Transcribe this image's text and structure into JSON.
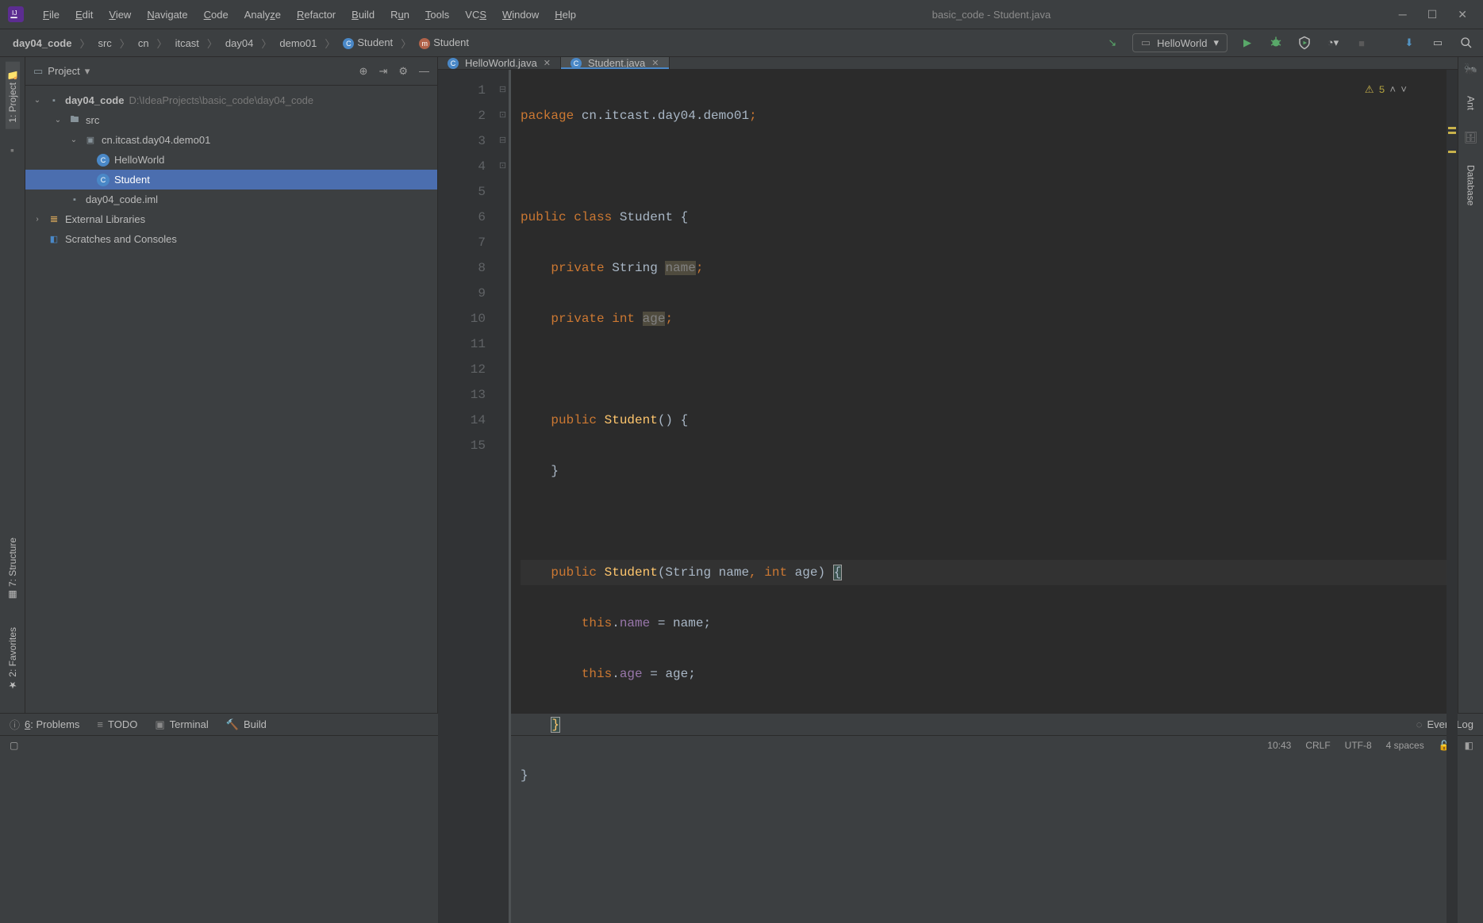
{
  "title_bar": {
    "window_title": "basic_code - Student.java",
    "menu": [
      "File",
      "Edit",
      "View",
      "Navigate",
      "Code",
      "Analyze",
      "Refactor",
      "Build",
      "Run",
      "Tools",
      "VCS",
      "Window",
      "Help"
    ],
    "menu_accel": [
      "F",
      "E",
      "V",
      "N",
      "C",
      "A",
      "R",
      "B",
      "R",
      "T",
      "V",
      "W",
      "H"
    ]
  },
  "breadcrumb": {
    "items": [
      "day04_code",
      "src",
      "cn",
      "itcast",
      "day04",
      "demo01",
      "Student",
      "Student"
    ]
  },
  "toolbar": {
    "run_config": "HelloWorld"
  },
  "project_panel": {
    "title": "Project",
    "tree": {
      "root": "day04_code",
      "root_path": "D:\\IdeaProjects\\basic_code\\day04_code",
      "src": "src",
      "pkg": "cn.itcast.day04.demo01",
      "class1": "HelloWorld",
      "class2": "Student",
      "iml": "day04_code.iml",
      "ext_lib": "External Libraries",
      "scratches": "Scratches and Consoles"
    }
  },
  "editor": {
    "tabs": [
      {
        "label": "HelloWorld.java",
        "active": false
      },
      {
        "label": "Student.java",
        "active": true
      }
    ],
    "inspection": {
      "warn_count": "5"
    },
    "code": {
      "l1_1": "package",
      "l1_2": " cn.itcast.day04.demo01",
      "l1_3": ";",
      "l3_1": "public",
      "l3_2": " class ",
      "l3_3": "Student ",
      "l3_4": "{",
      "l4_1": "    private",
      "l4_2": " String ",
      "l4_3": "name",
      "l4_4": ";",
      "l5_1": "    private",
      "l5_2": " int ",
      "l5_3": "age",
      "l5_4": ";",
      "l7_1": "    public",
      "l7_2": " Student",
      "l7_3": "() {",
      "l8": "    }",
      "l10_1": "    public",
      "l10_2": " Student",
      "l10_3": "(String name",
      "l10_4": ",",
      "l10_5": " int ",
      "l10_6": "age) ",
      "l10_7": "{",
      "l11_1": "        this",
      "l11_2": ".",
      "l11_3": "name",
      "l11_4": " = name;",
      "l12_1": "        this",
      "l12_2": ".",
      "l12_3": "age",
      "l12_4": " = age;",
      "l13": "    ",
      "l13_2": "}",
      "l14": "}"
    },
    "line_numbers": [
      "1",
      "2",
      "3",
      "4",
      "5",
      "6",
      "7",
      "8",
      "9",
      "10",
      "11",
      "12",
      "13",
      "14",
      "15"
    ]
  },
  "left_sidebar": {
    "project": "1: Project",
    "structure": "7: Structure",
    "favorites": "2: Favorites"
  },
  "right_sidebar": {
    "ant": "Ant",
    "database": "Database"
  },
  "bottom_bar": {
    "problems": "6: Problems",
    "todo": "TODO",
    "terminal": "Terminal",
    "build": "Build",
    "event_log": "Event Log"
  },
  "status_bar": {
    "pos": "10:43",
    "le": "CRLF",
    "enc": "UTF-8",
    "indent": "4 spaces"
  }
}
